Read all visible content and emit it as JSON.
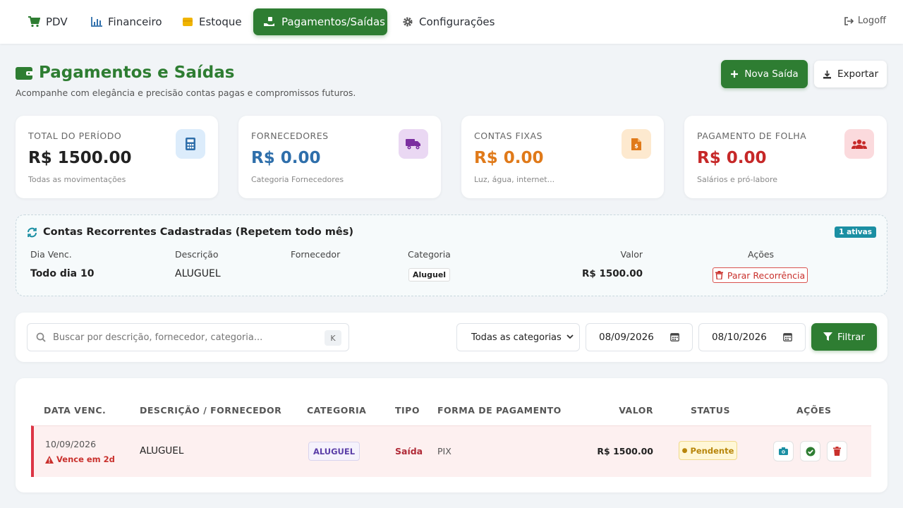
{
  "nav": {
    "items": [
      {
        "label": "PDV",
        "icon": "cart-icon"
      },
      {
        "label": "Financeiro",
        "icon": "bar-chart-icon"
      },
      {
        "label": "Estoque",
        "icon": "box-icon"
      },
      {
        "label": "Pagamentos/Saídas",
        "icon": "hand-money-icon",
        "active": true
      },
      {
        "label": "Configurações",
        "icon": "gear-icon"
      }
    ],
    "logoff": "Logoff"
  },
  "header": {
    "title": "Pagamentos e Saídas",
    "subtitle": "Acompanhe com elegância e precisão contas pagas e compromissos futuros.",
    "new_label": "Nova Saída",
    "export_label": "Exportar"
  },
  "colors": {
    "accent": "#2e7d32",
    "blue": "#2f6fab",
    "orange": "#e07a1a",
    "red": "#c62828",
    "danger": "#dc3545"
  },
  "cards": [
    {
      "label": "TOTAL DO PERÍODO",
      "value": "R$ 1500.00",
      "note": "Todas as movimentações",
      "icon": "calculator-icon"
    },
    {
      "label": "FORNECEDORES",
      "value": "R$ 0.00",
      "note": "Categoria Fornecedores",
      "icon": "truck-icon"
    },
    {
      "label": "CONTAS FIXAS",
      "value": "R$ 0.00",
      "note": "Luz, água, internet...",
      "icon": "invoice-dollar-icon"
    },
    {
      "label": "PAGAMENTO DE FOLHA",
      "value": "R$ 0.00",
      "note": "Salários e pró-labore",
      "icon": "users-icon"
    }
  ],
  "recurring": {
    "title": "Contas Recorrentes Cadastradas (Repetem todo mês)",
    "badge": "1 ativas",
    "headers": {
      "day": "Dia Venc.",
      "desc": "Descrição",
      "supplier": "Fornecedor",
      "category": "Categoria",
      "value": "Valor",
      "actions": "Ações"
    },
    "row": {
      "day": "Todo dia 10",
      "desc": "ALUGUEL",
      "supplier": "",
      "category": "Aluguel",
      "value": "R$ 1500.00",
      "action": "Parar Recorrência"
    }
  },
  "filters": {
    "search_placeholder": "Buscar por descrição, fornecedor, categoria...",
    "shortcut": "K",
    "category": "Todas as categorias",
    "date_from": "08/09/2026",
    "date_to": "08/10/2026",
    "filter_label": "Filtrar"
  },
  "table": {
    "headers": {
      "date": "DATA VENC.",
      "desc": "DESCRIÇÃO / FORNECEDOR",
      "category": "CATEGORIA",
      "type": "TIPO",
      "method": "FORMA DE PAGAMENTO",
      "value": "VALOR",
      "status": "STATUS",
      "actions": "AÇÕES"
    },
    "rows": [
      {
        "date": "10/09/2026",
        "due": "Vence em 2d",
        "desc": "ALUGUEL",
        "category": "ALUGUEL",
        "type": "Saída",
        "method": "PIX",
        "value": "R$ 1500.00",
        "status": "Pendente"
      }
    ]
  }
}
